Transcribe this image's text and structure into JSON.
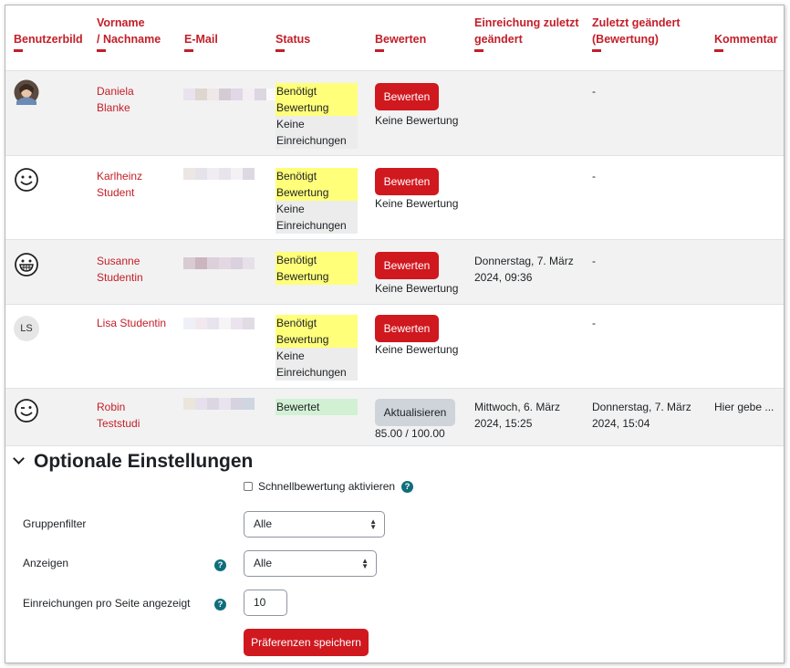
{
  "headers": {
    "picture": "Benutzerbild",
    "firstname": "Vorname",
    "lastname": "/ Nachname",
    "email": "E-Mail",
    "status": "Status",
    "grade": "Bewerten",
    "modified_line1": "Einreichung zuletzt",
    "modified_line2": "geändert",
    "grademod_line1": "Zuletzt geändert",
    "grademod_line2": "(Bewertung)",
    "comment": "Kommentar"
  },
  "rows": [
    {
      "first": "Daniela",
      "last": "Blanke",
      "status_grade": [
        "Benötigt",
        "Bewertung"
      ],
      "status_sub": [
        "Keine",
        "Einreichungen"
      ],
      "button": "Bewerten",
      "grade": "Keine Bewertung",
      "submitted": [
        "",
        ""
      ],
      "grade_modified": "-",
      "comment": ""
    },
    {
      "first": "Karlheinz",
      "last": "Student",
      "status_grade": [
        "Benötigt",
        "Bewertung"
      ],
      "status_sub": [
        "Keine",
        "Einreichungen"
      ],
      "button": "Bewerten",
      "grade": "Keine Bewertung",
      "submitted": [
        "",
        ""
      ],
      "grade_modified": "-",
      "comment": ""
    },
    {
      "first": "Susanne",
      "last": "Studentin",
      "status_grade": [
        "Benötigt",
        "Bewertung"
      ],
      "status_sub": [
        "",
        ""
      ],
      "button": "Bewerten",
      "grade": "Keine Bewertung",
      "submitted": [
        "Donnerstag, 7. März",
        "2024, 09:36"
      ],
      "grade_modified": "-",
      "comment": ""
    },
    {
      "first": "Lisa Studentin",
      "last": "",
      "initials": "LS",
      "status_grade": [
        "Benötigt",
        "Bewertung"
      ],
      "status_sub": [
        "Keine",
        "Einreichungen"
      ],
      "button": "Bewerten",
      "grade": "Keine Bewertung",
      "submitted": [
        "",
        ""
      ],
      "grade_modified": "-",
      "comment": ""
    },
    {
      "first": "Robin",
      "last": "Teststudi",
      "status_grade": [
        "Bewertet",
        ""
      ],
      "status_sub": [
        "",
        ""
      ],
      "button": "Aktualisieren",
      "grade": "85.00 / 100.00",
      "submitted": [
        "Mittwoch, 6. März",
        "2024, 15:25"
      ],
      "grade_modified_lines": [
        "Donnerstag, 7. März",
        "2024, 15:04"
      ],
      "comment": "Hier gebe ..."
    }
  ],
  "options": {
    "title": "Optionale Einstellungen",
    "quickgrading_label": "Schnellbewertung aktivieren",
    "groupfilter_label": "Gruppenfilter",
    "groupfilter_value": "Alle",
    "show_label": "Anzeigen",
    "show_value": "Alle",
    "perpage_label": "Einreichungen pro Seite angezeigt",
    "perpage_value": "10",
    "save_button": "Präferenzen speichern"
  },
  "colors": {
    "accent": "#c31e28",
    "button_red": "#d0181f",
    "status_needs_grading": "#ffff7a",
    "status_no_submission": "#ececec",
    "status_graded": "#d2f0d4",
    "help_icon": "#0f6e7a"
  }
}
